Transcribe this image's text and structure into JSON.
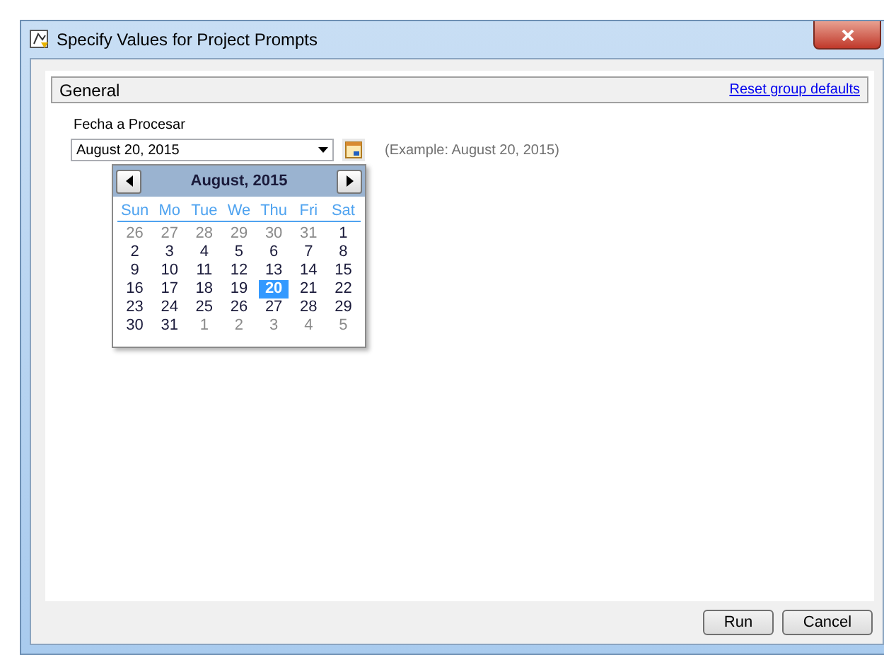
{
  "window": {
    "title": "Specify Values for Project Prompts"
  },
  "group": {
    "title": "General",
    "reset_link": "Reset group defaults"
  },
  "prompt": {
    "label": "Fecha a Procesar",
    "value": "August 20, 2015",
    "example": "(Example: August 20, 2015)"
  },
  "calendar": {
    "month": "August, 2015",
    "weekdays": [
      "Sun",
      "Mo",
      "Tue",
      "We",
      "Thu",
      "Fri",
      "Sat"
    ],
    "weeks": [
      [
        {
          "day": "26",
          "other_month": true,
          "selected": false
        },
        {
          "day": "27",
          "other_month": true,
          "selected": false
        },
        {
          "day": "28",
          "other_month": true,
          "selected": false
        },
        {
          "day": "29",
          "other_month": true,
          "selected": false
        },
        {
          "day": "30",
          "other_month": true,
          "selected": false
        },
        {
          "day": "31",
          "other_month": true,
          "selected": false
        },
        {
          "day": "1",
          "other_month": false,
          "selected": false
        }
      ],
      [
        {
          "day": "2",
          "other_month": false,
          "selected": false
        },
        {
          "day": "3",
          "other_month": false,
          "selected": false
        },
        {
          "day": "4",
          "other_month": false,
          "selected": false
        },
        {
          "day": "5",
          "other_month": false,
          "selected": false
        },
        {
          "day": "6",
          "other_month": false,
          "selected": false
        },
        {
          "day": "7",
          "other_month": false,
          "selected": false
        },
        {
          "day": "8",
          "other_month": false,
          "selected": false
        }
      ],
      [
        {
          "day": "9",
          "other_month": false,
          "selected": false
        },
        {
          "day": "10",
          "other_month": false,
          "selected": false
        },
        {
          "day": "11",
          "other_month": false,
          "selected": false
        },
        {
          "day": "12",
          "other_month": false,
          "selected": false
        },
        {
          "day": "13",
          "other_month": false,
          "selected": false
        },
        {
          "day": "14",
          "other_month": false,
          "selected": false
        },
        {
          "day": "15",
          "other_month": false,
          "selected": false
        }
      ],
      [
        {
          "day": "16",
          "other_month": false,
          "selected": false
        },
        {
          "day": "17",
          "other_month": false,
          "selected": false
        },
        {
          "day": "18",
          "other_month": false,
          "selected": false
        },
        {
          "day": "19",
          "other_month": false,
          "selected": false
        },
        {
          "day": "20",
          "other_month": false,
          "selected": true
        },
        {
          "day": "21",
          "other_month": false,
          "selected": false
        },
        {
          "day": "22",
          "other_month": false,
          "selected": false
        }
      ],
      [
        {
          "day": "23",
          "other_month": false,
          "selected": false
        },
        {
          "day": "24",
          "other_month": false,
          "selected": false
        },
        {
          "day": "25",
          "other_month": false,
          "selected": false
        },
        {
          "day": "26",
          "other_month": false,
          "selected": false
        },
        {
          "day": "27",
          "other_month": false,
          "selected": false
        },
        {
          "day": "28",
          "other_month": false,
          "selected": false
        },
        {
          "day": "29",
          "other_month": false,
          "selected": false
        }
      ],
      [
        {
          "day": "30",
          "other_month": false,
          "selected": false
        },
        {
          "day": "31",
          "other_month": false,
          "selected": false
        },
        {
          "day": "1",
          "other_month": true,
          "selected": false
        },
        {
          "day": "2",
          "other_month": true,
          "selected": false
        },
        {
          "day": "3",
          "other_month": true,
          "selected": false
        },
        {
          "day": "4",
          "other_month": true,
          "selected": false
        },
        {
          "day": "5",
          "other_month": true,
          "selected": false
        }
      ]
    ]
  },
  "buttons": [
    "Run",
    "Cancel"
  ]
}
